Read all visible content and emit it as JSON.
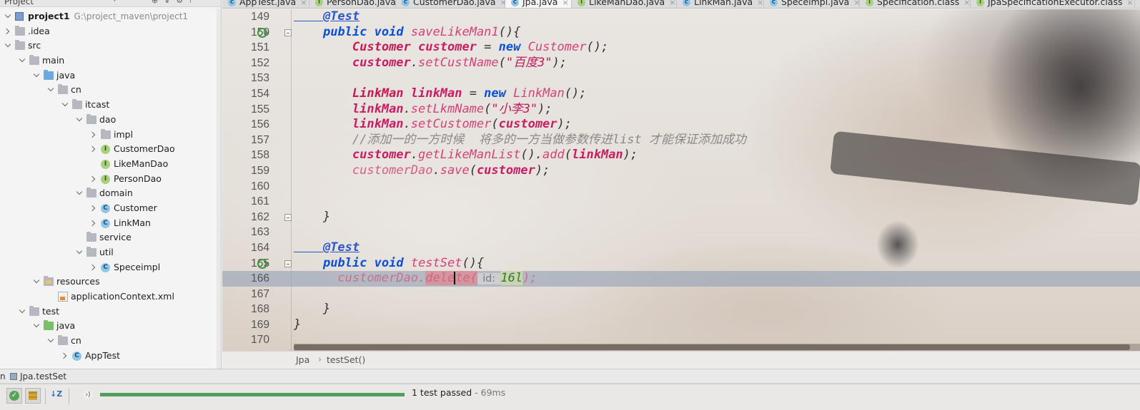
{
  "project_panel": {
    "title": "Project",
    "tree": [
      {
        "label": "project1",
        "path": "G:\\project_maven\\project1",
        "depth": 0,
        "expanded": true,
        "icon": "module-icon",
        "bold": true
      },
      {
        "label": ".idea",
        "depth": 0,
        "expanded": false,
        "icon": "folder-icon"
      },
      {
        "label": "src",
        "depth": 0,
        "expanded": true,
        "icon": "folder-icon"
      },
      {
        "label": "main",
        "depth": 1,
        "expanded": true,
        "icon": "folder-icon"
      },
      {
        "label": "java",
        "depth": 2,
        "expanded": true,
        "icon": "source-folder-icon"
      },
      {
        "label": "cn",
        "depth": 3,
        "expanded": true,
        "icon": "package-icon"
      },
      {
        "label": "itcast",
        "depth": 4,
        "expanded": true,
        "icon": "package-icon"
      },
      {
        "label": "dao",
        "depth": 5,
        "expanded": true,
        "icon": "package-icon"
      },
      {
        "label": "impl",
        "depth": 6,
        "expanded": false,
        "icon": "package-icon"
      },
      {
        "label": "CustomerDao",
        "depth": 6,
        "expanded": false,
        "icon": "interface-icon"
      },
      {
        "label": "LikeManDao",
        "depth": 6,
        "icon": "interface-icon"
      },
      {
        "label": "PersonDao",
        "depth": 6,
        "expanded": false,
        "icon": "interface-icon"
      },
      {
        "label": "domain",
        "depth": 5,
        "expanded": true,
        "icon": "package-icon"
      },
      {
        "label": "Customer",
        "depth": 6,
        "expanded": false,
        "icon": "class-icon"
      },
      {
        "label": "LinkMan",
        "depth": 6,
        "expanded": false,
        "icon": "class-icon"
      },
      {
        "label": "service",
        "depth": 5,
        "icon": "package-icon"
      },
      {
        "label": "util",
        "depth": 5,
        "expanded": true,
        "icon": "package-icon"
      },
      {
        "label": "Speceimpl",
        "depth": 6,
        "expanded": false,
        "icon": "class-icon"
      },
      {
        "label": "resources",
        "depth": 2,
        "expanded": true,
        "icon": "resources-folder-icon"
      },
      {
        "label": "applicationContext.xml",
        "depth": 3,
        "icon": "xml-file-icon"
      },
      {
        "label": "test",
        "depth": 1,
        "expanded": true,
        "icon": "folder-icon"
      },
      {
        "label": "java",
        "depth": 2,
        "expanded": true,
        "icon": "test-folder-icon"
      },
      {
        "label": "cn",
        "depth": 3,
        "expanded": true,
        "icon": "package-icon"
      },
      {
        "label": "AppTest",
        "depth": 4,
        "expanded": false,
        "icon": "class-icon"
      }
    ]
  },
  "tabs": [
    {
      "label": "AppTest.java",
      "icon": "class-icon",
      "active": false
    },
    {
      "label": "PersonDao.java",
      "icon": "interface-icon",
      "active": false
    },
    {
      "label": "CustomerDao.java",
      "icon": "class-icon",
      "active": false
    },
    {
      "label": "Jpa.java",
      "icon": "class-icon",
      "active": true
    },
    {
      "label": "LikeManDao.java",
      "icon": "interface-icon",
      "active": false
    },
    {
      "label": "LinkMan.java",
      "icon": "class-icon",
      "active": false
    },
    {
      "label": "Speceimpl.java",
      "icon": "class-icon",
      "active": false
    },
    {
      "label": "Specification.class",
      "icon": "interface-icon",
      "active": false
    },
    {
      "label": "JpaSpecificationExecutor.class",
      "icon": "interface-icon",
      "active": false
    }
  ],
  "editor": {
    "current_line": 166,
    "lines": [
      {
        "n": "149",
        "tokens": [
          [
            "    @Test",
            "ann"
          ]
        ]
      },
      {
        "n": "150",
        "gutter": "run",
        "fold": true,
        "tokens": [
          [
            "    ",
            ""
          ],
          [
            "public",
            "kw"
          ],
          [
            " ",
            ""
          ],
          [
            "void",
            "kw"
          ],
          [
            " ",
            ""
          ],
          [
            "saveLikeMan1",
            "fn"
          ],
          [
            "(){",
            "pun"
          ]
        ]
      },
      {
        "n": "151",
        "tokens": [
          [
            "        ",
            ""
          ],
          [
            "Customer",
            "typ"
          ],
          [
            " ",
            ""
          ],
          [
            "customer",
            "var"
          ],
          [
            " = ",
            "pun"
          ],
          [
            "new",
            "kw"
          ],
          [
            " ",
            ""
          ],
          [
            "Customer",
            "fn"
          ],
          [
            "();",
            "pun"
          ]
        ]
      },
      {
        "n": "152",
        "tokens": [
          [
            "        ",
            ""
          ],
          [
            "customer",
            "var"
          ],
          [
            ".",
            "pun"
          ],
          [
            "setCustName",
            "fn"
          ],
          [
            "(",
            "pun"
          ],
          [
            "\"百度3\"",
            "str"
          ],
          [
            ");",
            "pun"
          ]
        ]
      },
      {
        "n": "153",
        "tokens": []
      },
      {
        "n": "154",
        "tokens": [
          [
            "        ",
            ""
          ],
          [
            "LinkMan",
            "typ"
          ],
          [
            " ",
            ""
          ],
          [
            "linkMan",
            "var"
          ],
          [
            " = ",
            "pun"
          ],
          [
            "new",
            "kw"
          ],
          [
            " ",
            ""
          ],
          [
            "LinkMan",
            "fn"
          ],
          [
            "();",
            "pun"
          ]
        ]
      },
      {
        "n": "155",
        "tokens": [
          [
            "        ",
            ""
          ],
          [
            "linkMan",
            "var"
          ],
          [
            ".",
            "pun"
          ],
          [
            "setLkmName",
            "fn"
          ],
          [
            "(",
            "pun"
          ],
          [
            "\"小李3\"",
            "str"
          ],
          [
            ");",
            "pun"
          ]
        ]
      },
      {
        "n": "156",
        "tokens": [
          [
            "        ",
            ""
          ],
          [
            "linkMan",
            "var"
          ],
          [
            ".",
            "pun"
          ],
          [
            "setCustomer",
            "fn"
          ],
          [
            "(",
            "pun"
          ],
          [
            "customer",
            "var"
          ],
          [
            ");",
            "pun"
          ]
        ]
      },
      {
        "n": "157",
        "tokens": [
          [
            "        ",
            ""
          ],
          [
            "//添加一的一方时候  将多的一方当做参数传进list 才能保证添加成功",
            "cmt"
          ]
        ]
      },
      {
        "n": "158",
        "tokens": [
          [
            "        ",
            ""
          ],
          [
            "customer",
            "var"
          ],
          [
            ".",
            "pun"
          ],
          [
            "getLikeManList",
            "fn"
          ],
          [
            "().",
            "pun"
          ],
          [
            "add",
            "fn"
          ],
          [
            "(",
            "pun"
          ],
          [
            "linkMan",
            "var"
          ],
          [
            ");",
            "pun"
          ]
        ]
      },
      {
        "n": "159",
        "tokens": [
          [
            "        ",
            ""
          ],
          [
            "customerDao",
            "fld"
          ],
          [
            ".",
            "pun"
          ],
          [
            "save",
            "fn"
          ],
          [
            "(",
            "pun"
          ],
          [
            "customer",
            "var"
          ],
          [
            ");",
            "pun"
          ]
        ]
      },
      {
        "n": "160",
        "tokens": []
      },
      {
        "n": "161",
        "tokens": []
      },
      {
        "n": "162",
        "fold": true,
        "tokens": [
          [
            "    }",
            "pun"
          ]
        ]
      },
      {
        "n": "163",
        "tokens": []
      },
      {
        "n": "164",
        "tokens": [
          [
            "    @Test",
            "ann"
          ]
        ]
      },
      {
        "n": "165",
        "gutter": "run",
        "fold": true,
        "tokens": [
          [
            "    ",
            ""
          ],
          [
            "public",
            "kw"
          ],
          [
            " ",
            ""
          ],
          [
            "void",
            "kw"
          ],
          [
            " ",
            ""
          ],
          [
            "testSet",
            "fn"
          ],
          [
            "(){",
            "pun"
          ]
        ]
      },
      {
        "n": "166",
        "tokens": [
          [
            "      ",
            ""
          ],
          [
            "customerDao",
            "dim"
          ],
          [
            ".",
            "dim"
          ],
          [
            "dele",
            "dim hl-red"
          ],
          [
            "|",
            "caret"
          ],
          [
            "te(",
            "dim hl-red"
          ],
          [
            " id: ",
            "hint"
          ],
          [
            "16l",
            "num"
          ],
          [
            ");",
            "dim"
          ]
        ]
      },
      {
        "n": "167",
        "tokens": []
      },
      {
        "n": "168",
        "tokens": [
          [
            "    }",
            "pun"
          ]
        ]
      },
      {
        "n": "169",
        "tokens": [
          [
            "}",
            "pun"
          ]
        ]
      },
      {
        "n": "170",
        "tokens": []
      }
    ]
  },
  "breadcrumb": {
    "class_name": "Jpa",
    "method_name": "testSet()"
  },
  "run_panel": {
    "cut_label": "n",
    "tab_label": "Jpa.testSet",
    "status": "1 test passed",
    "separator": "-",
    "duration": "69ms",
    "progress_fraction": 1.0,
    "cursor_label": "›)"
  },
  "colors": {
    "keyword": "#0a50d8",
    "type": "#c41a55",
    "string": "#c2185b",
    "comment": "#8a8a8a",
    "progress": "#4f9e5c",
    "current_line": "#94a2b6"
  }
}
